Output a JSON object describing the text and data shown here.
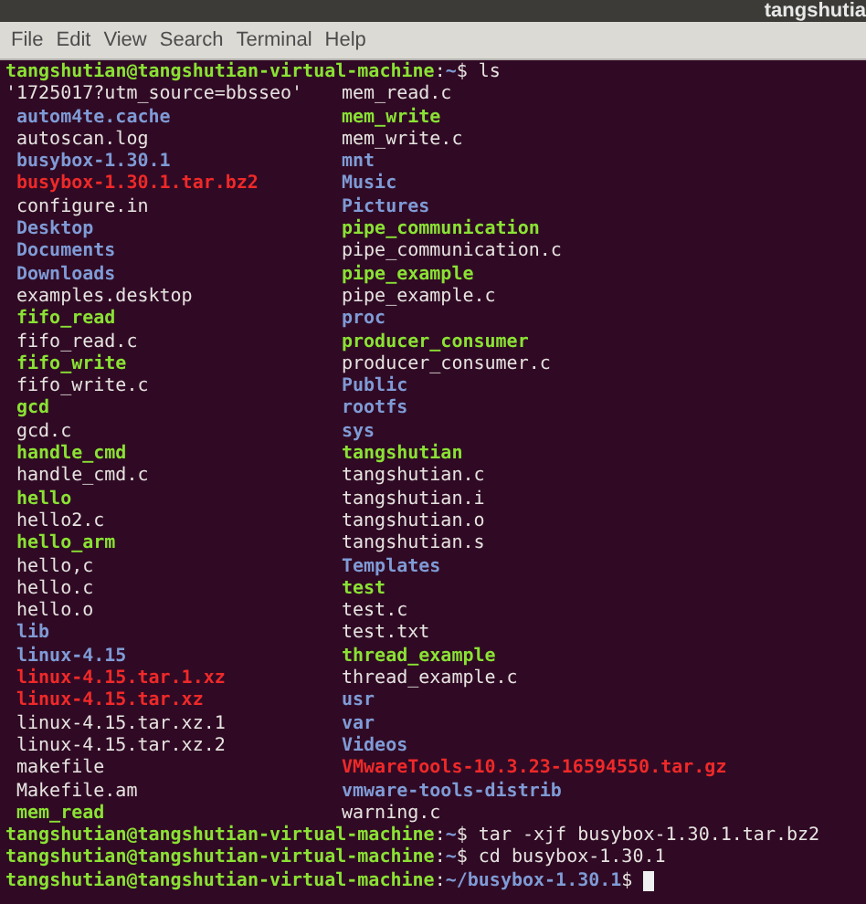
{
  "window": {
    "title": "tangshutia"
  },
  "menu": [
    "File",
    "Edit",
    "View",
    "Search",
    "Terminal",
    "Help"
  ],
  "session": [
    {
      "kind": "prompt",
      "user_host": "tangshutian@tangshutian-virtual-machine",
      "separator": ":",
      "path": "~",
      "command": "$ ls"
    },
    {
      "kind": "listing",
      "rows": [
        {
          "left": {
            "name": "'1725017?utm_source=bbsseo'",
            "kind": "file"
          },
          "right": {
            "name": "mem_read.c",
            "kind": "file"
          }
        },
        {
          "left": {
            "name": "autom4te.cache",
            "kind": "dir"
          },
          "right": {
            "name": "mem_write",
            "kind": "exec"
          }
        },
        {
          "left": {
            "name": "autoscan.log",
            "kind": "file"
          },
          "right": {
            "name": "mem_write.c",
            "kind": "file"
          }
        },
        {
          "left": {
            "name": "busybox-1.30.1",
            "kind": "dir"
          },
          "right": {
            "name": "mnt",
            "kind": "dir"
          }
        },
        {
          "left": {
            "name": "busybox-1.30.1.tar.bz2",
            "kind": "archive"
          },
          "right": {
            "name": "Music",
            "kind": "dir"
          }
        },
        {
          "left": {
            "name": "configure.in",
            "kind": "file"
          },
          "right": {
            "name": "Pictures",
            "kind": "dir"
          }
        },
        {
          "left": {
            "name": "Desktop",
            "kind": "dir"
          },
          "right": {
            "name": "pipe_communication",
            "kind": "exec"
          }
        },
        {
          "left": {
            "name": "Documents",
            "kind": "dir"
          },
          "right": {
            "name": "pipe_communication.c",
            "kind": "file"
          }
        },
        {
          "left": {
            "name": "Downloads",
            "kind": "dir"
          },
          "right": {
            "name": "pipe_example",
            "kind": "exec"
          }
        },
        {
          "left": {
            "name": "examples.desktop",
            "kind": "file"
          },
          "right": {
            "name": "pipe_example.c",
            "kind": "file"
          }
        },
        {
          "left": {
            "name": "fifo_read",
            "kind": "exec"
          },
          "right": {
            "name": "proc",
            "kind": "dir"
          }
        },
        {
          "left": {
            "name": "fifo_read.c",
            "kind": "file"
          },
          "right": {
            "name": "producer_consumer",
            "kind": "exec"
          }
        },
        {
          "left": {
            "name": "fifo_write",
            "kind": "exec"
          },
          "right": {
            "name": "producer_consumer.c",
            "kind": "file"
          }
        },
        {
          "left": {
            "name": "fifo_write.c",
            "kind": "file"
          },
          "right": {
            "name": "Public",
            "kind": "dir"
          }
        },
        {
          "left": {
            "name": "gcd",
            "kind": "exec"
          },
          "right": {
            "name": "rootfs",
            "kind": "dir"
          }
        },
        {
          "left": {
            "name": "gcd.c",
            "kind": "file"
          },
          "right": {
            "name": "sys",
            "kind": "dir"
          }
        },
        {
          "left": {
            "name": "handle_cmd",
            "kind": "exec"
          },
          "right": {
            "name": "tangshutian",
            "kind": "exec"
          }
        },
        {
          "left": {
            "name": "handle_cmd.c",
            "kind": "file"
          },
          "right": {
            "name": "tangshutian.c",
            "kind": "file"
          }
        },
        {
          "left": {
            "name": "hello",
            "kind": "exec"
          },
          "right": {
            "name": "tangshutian.i",
            "kind": "file"
          }
        },
        {
          "left": {
            "name": "hello2.c",
            "kind": "file"
          },
          "right": {
            "name": "tangshutian.o",
            "kind": "file"
          }
        },
        {
          "left": {
            "name": "hello_arm",
            "kind": "exec"
          },
          "right": {
            "name": "tangshutian.s",
            "kind": "file"
          }
        },
        {
          "left": {
            "name": "hello,c",
            "kind": "file"
          },
          "right": {
            "name": "Templates",
            "kind": "dir"
          }
        },
        {
          "left": {
            "name": "hello.c",
            "kind": "file"
          },
          "right": {
            "name": "test",
            "kind": "exec"
          }
        },
        {
          "left": {
            "name": "hello.o",
            "kind": "file"
          },
          "right": {
            "name": "test.c",
            "kind": "file"
          }
        },
        {
          "left": {
            "name": "lib",
            "kind": "dir"
          },
          "right": {
            "name": "test.txt",
            "kind": "file"
          }
        },
        {
          "left": {
            "name": "linux-4.15",
            "kind": "dir"
          },
          "right": {
            "name": "thread_example",
            "kind": "exec"
          }
        },
        {
          "left": {
            "name": "linux-4.15.tar.1.xz",
            "kind": "archive"
          },
          "right": {
            "name": "thread_example.c",
            "kind": "file"
          }
        },
        {
          "left": {
            "name": "linux-4.15.tar.xz",
            "kind": "archive"
          },
          "right": {
            "name": "usr",
            "kind": "dir"
          }
        },
        {
          "left": {
            "name": "linux-4.15.tar.xz.1",
            "kind": "file"
          },
          "right": {
            "name": "var",
            "kind": "dir"
          }
        },
        {
          "left": {
            "name": "linux-4.15.tar.xz.2",
            "kind": "file"
          },
          "right": {
            "name": "Videos",
            "kind": "dir"
          }
        },
        {
          "left": {
            "name": "makefile",
            "kind": "file"
          },
          "right": {
            "name": "VMwareTools-10.3.23-16594550.tar.gz",
            "kind": "archive"
          }
        },
        {
          "left": {
            "name": "Makefile.am",
            "kind": "file"
          },
          "right": {
            "name": "vmware-tools-distrib",
            "kind": "dir"
          }
        },
        {
          "left": {
            "name": "mem_read",
            "kind": "exec"
          },
          "right": {
            "name": "warning.c",
            "kind": "file"
          }
        }
      ]
    },
    {
      "kind": "prompt",
      "user_host": "tangshutian@tangshutian-virtual-machine",
      "separator": ":",
      "path": "~",
      "command": "$ tar -xjf busybox-1.30.1.tar.bz2"
    },
    {
      "kind": "prompt",
      "user_host": "tangshutian@tangshutian-virtual-machine",
      "separator": ":",
      "path": "~",
      "command": "$ cd busybox-1.30.1"
    },
    {
      "kind": "prompt",
      "user_host": "tangshutian@tangshutian-virtual-machine",
      "separator": ":",
      "path": "~/busybox-1.30.1",
      "command": "$",
      "cursor": true
    }
  ]
}
